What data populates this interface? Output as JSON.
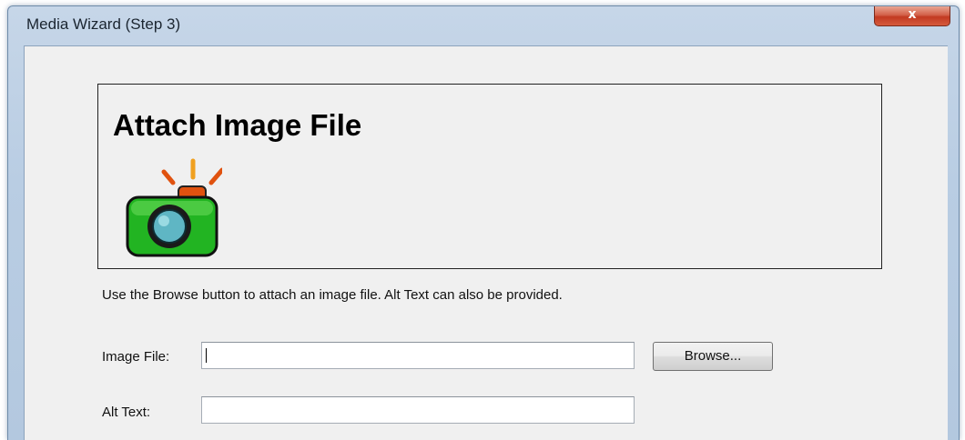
{
  "window": {
    "title": "Media Wizard (Step 3)",
    "close_glyph": "x"
  },
  "header": {
    "title": "Attach Image File",
    "icon": "camera-icon"
  },
  "instructions": "Use the Browse button to attach an image file.  Alt Text can also be provided.",
  "form": {
    "image_file": {
      "label": "Image File:",
      "value": ""
    },
    "browse_label": "Browse...",
    "alt_text": {
      "label": "Alt Text:",
      "value": ""
    }
  },
  "colors": {
    "camera_body": "#22b422",
    "camera_flash": "#e0520f",
    "lens": "#5fb6c4"
  }
}
